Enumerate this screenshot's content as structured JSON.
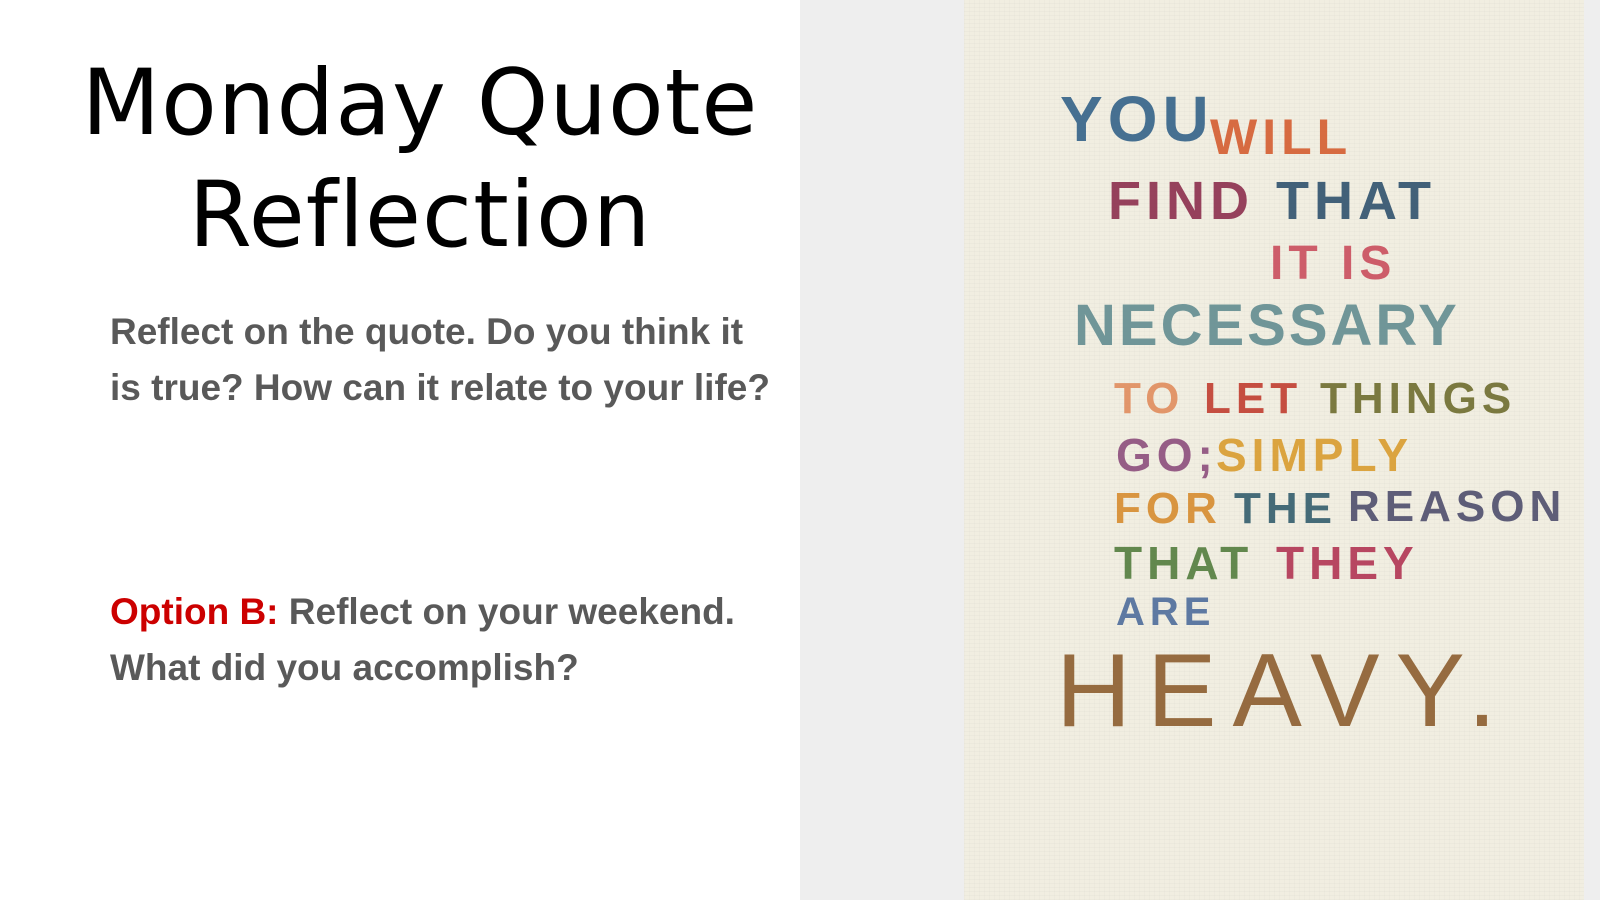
{
  "slide": {
    "title_line1": "Monday Quote",
    "title_line2": "Reflection",
    "paragraph1": "Reflect on the quote. Do you think it is true? How can it relate to your life?",
    "option_label": "Option B:",
    "option_text": " Reflect on your weekend. What did you accomplish?"
  },
  "quote_image": {
    "words": [
      {
        "text": "YOU",
        "color": "#2f5f87"
      },
      {
        "text": "WILL",
        "color": "#d45a2c"
      },
      {
        "text": "FIND",
        "color": "#8a2a4a"
      },
      {
        "text": "THAT",
        "color": "#2b4e6b"
      },
      {
        "text": "IT IS",
        "color": "#c94a5a"
      },
      {
        "text": "NECESSARY",
        "color": "#5f8a8f"
      },
      {
        "text": "TO",
        "color": "#e08a5a"
      },
      {
        "text": "LET",
        "color": "#c0392b"
      },
      {
        "text": "THINGS",
        "color": "#6b6a2a"
      },
      {
        "text": "GO;",
        "color": "#8a4a7a"
      },
      {
        "text": "SIMPLY",
        "color": "#d99a2a"
      },
      {
        "text": "FOR",
        "color": "#d6892a"
      },
      {
        "text": "THE",
        "color": "#2e5a6a"
      },
      {
        "text": "REASON",
        "color": "#4a4a6a"
      },
      {
        "text": "THAT",
        "color": "#4f7a3a"
      },
      {
        "text": "THEY",
        "color": "#b03050"
      },
      {
        "text": "ARE",
        "color": "#4a6a9a"
      },
      {
        "text": "HEAVY.",
        "color": "#8a5a2a"
      }
    ]
  }
}
